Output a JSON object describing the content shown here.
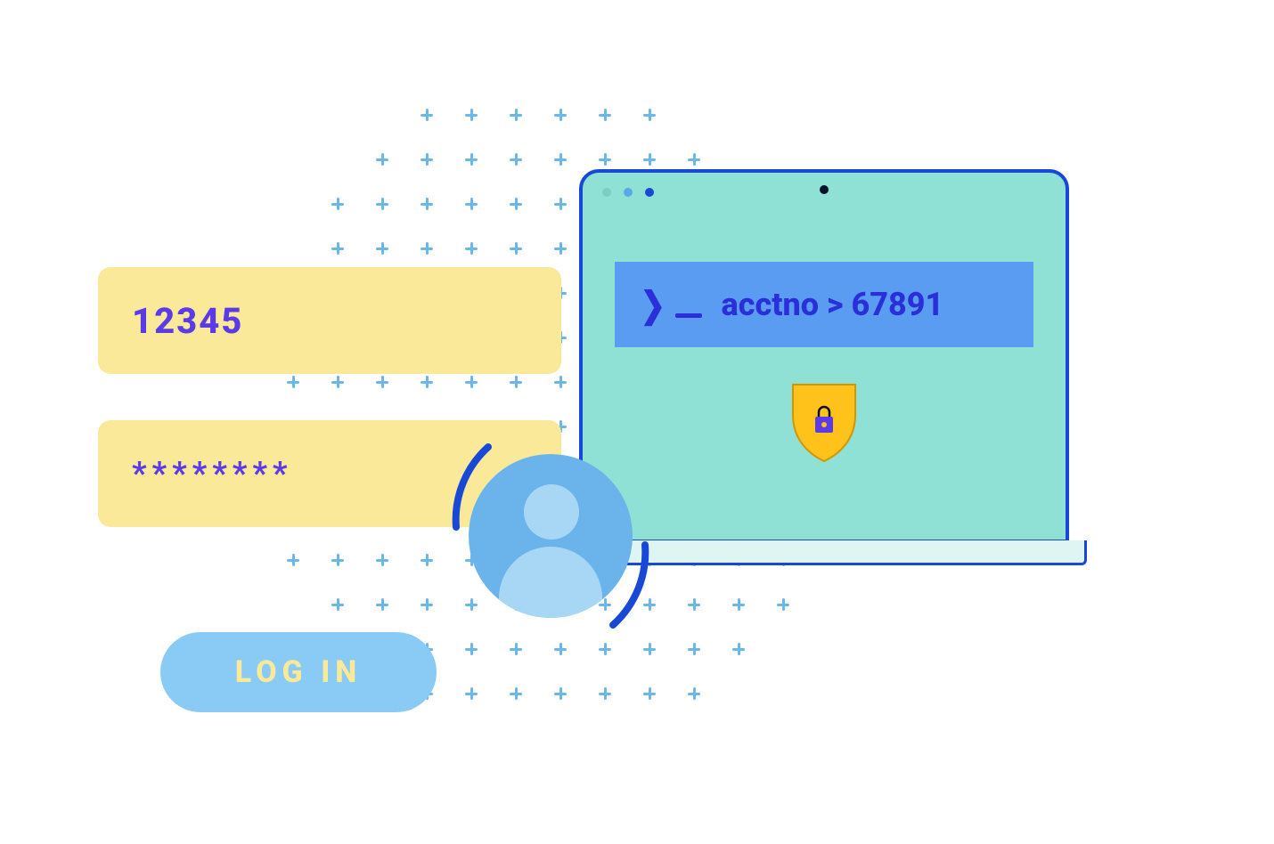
{
  "login": {
    "username_value": "12345",
    "password_mask": "********",
    "button_label": "LOG IN"
  },
  "terminal": {
    "command_text": "acctno > 67891"
  },
  "colors": {
    "field_bg": "#F9E999",
    "field_text": "#5B3BE8",
    "button_bg": "#8ACBF5",
    "button_text": "#F9E999",
    "screen_bg": "#8FE1D6",
    "screen_border": "#1849D6",
    "terminal_bg": "#5A9CF2",
    "terminal_text": "#2A2FD9",
    "avatar_bg": "#6AB3EB",
    "avatar_fg": "#A8D7F5",
    "shield": "#FFC21A",
    "plus_grid": "#6BB7E6"
  }
}
